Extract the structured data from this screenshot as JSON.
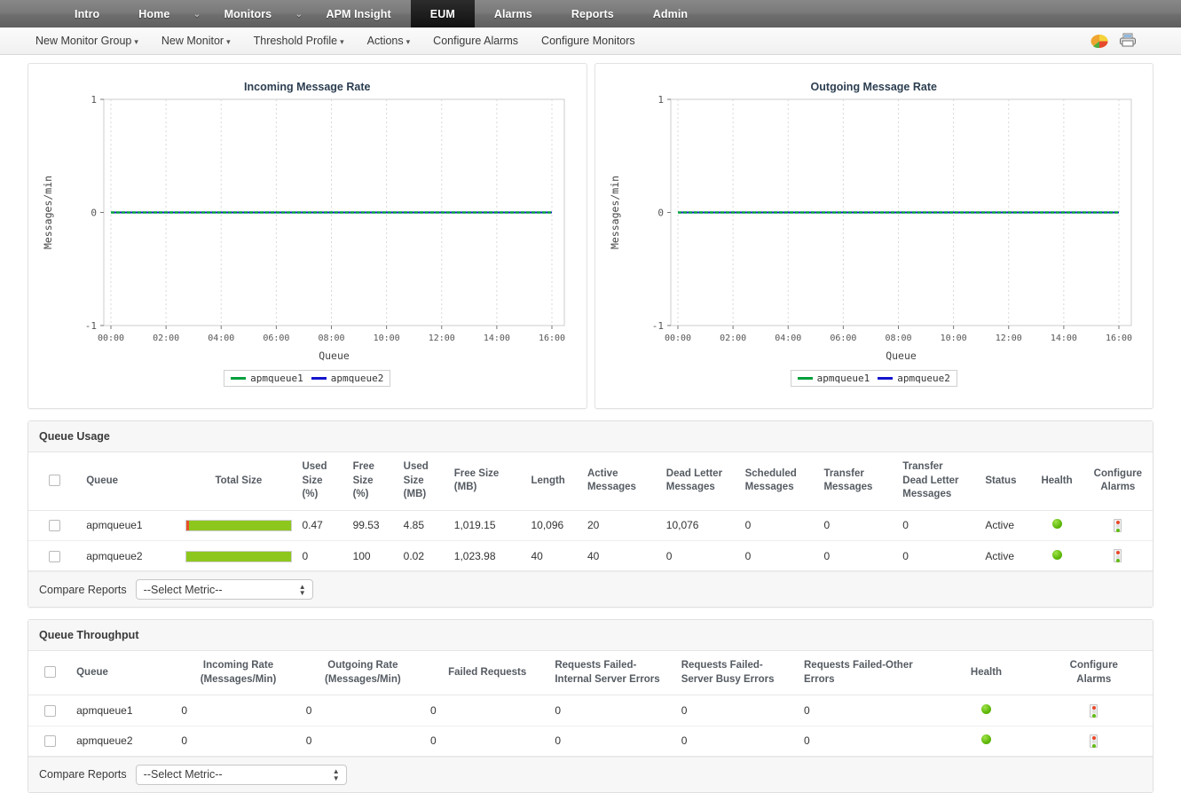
{
  "topnav": {
    "items": [
      {
        "label": "Intro",
        "active": false,
        "caret": false
      },
      {
        "label": "Home",
        "active": false,
        "caret": true
      },
      {
        "label": "Monitors",
        "active": false,
        "caret": true
      },
      {
        "label": "APM Insight",
        "active": false,
        "caret": false
      },
      {
        "label": "EUM",
        "active": true,
        "caret": false
      },
      {
        "label": "Alarms",
        "active": false,
        "caret": false
      },
      {
        "label": "Reports",
        "active": false,
        "caret": false
      },
      {
        "label": "Admin",
        "active": false,
        "caret": false
      }
    ],
    "caret_glyph": "⌄"
  },
  "subnav": {
    "items": [
      {
        "label": "New Monitor Group",
        "dropdown": true
      },
      {
        "label": "New Monitor",
        "dropdown": true
      },
      {
        "label": "Threshold Profile",
        "dropdown": true
      },
      {
        "label": "Actions",
        "dropdown": true
      },
      {
        "label": "Configure Alarms",
        "dropdown": false
      },
      {
        "label": "Configure Monitors",
        "dropdown": false
      }
    ],
    "dropdown_glyph": "▾",
    "icons": [
      "pie-chart-icon",
      "printer-icon"
    ]
  },
  "chart_data": [
    {
      "type": "line",
      "title": "Incoming Message Rate",
      "xlabel": "Queue",
      "ylabel": "Messages/min",
      "ylim": [
        -1,
        1
      ],
      "yticks": [
        "-1",
        "0",
        "1"
      ],
      "xticks": [
        "00:00",
        "02:00",
        "04:00",
        "06:00",
        "08:00",
        "10:00",
        "12:00",
        "14:00",
        "16:00"
      ],
      "grid": true,
      "legend_position": "bottom",
      "series": [
        {
          "name": "apmqueue1",
          "color": "#00a03c",
          "values": [
            0,
            0,
            0,
            0,
            0,
            0,
            0,
            0,
            0
          ]
        },
        {
          "name": "apmqueue2",
          "color": "#1414cc",
          "values": [
            0,
            0,
            0,
            0,
            0,
            0,
            0,
            0,
            0
          ]
        }
      ]
    },
    {
      "type": "line",
      "title": "Outgoing Message Rate",
      "xlabel": "Queue",
      "ylabel": "Messages/min",
      "ylim": [
        -1,
        1
      ],
      "yticks": [
        "-1",
        "0",
        "1"
      ],
      "xticks": [
        "00:00",
        "02:00",
        "04:00",
        "06:00",
        "08:00",
        "10:00",
        "12:00",
        "14:00",
        "16:00"
      ],
      "grid": true,
      "legend_position": "bottom",
      "series": [
        {
          "name": "apmqueue1",
          "color": "#00a03c",
          "values": [
            0,
            0,
            0,
            0,
            0,
            0,
            0,
            0,
            0
          ]
        },
        {
          "name": "apmqueue2",
          "color": "#1414cc",
          "values": [
            0,
            0,
            0,
            0,
            0,
            0,
            0,
            0,
            0
          ]
        }
      ]
    }
  ],
  "queue_usage": {
    "title": "Queue Usage",
    "columns": [
      "",
      "Queue",
      "Total Size",
      "Used Size (%)",
      "Free Size (%)",
      "Used Size (MB)",
      "Free Size (MB)",
      "Length",
      "Active Messages",
      "Dead Letter Messages",
      "Scheduled Messages",
      "Transfer Messages",
      "Transfer Dead Letter Messages",
      "Status",
      "Health",
      "Configure Alarms"
    ],
    "columns_multiline": [
      [
        "",
        ""
      ],
      [
        "Queue"
      ],
      [
        "Total Size"
      ],
      [
        "Used",
        "Size",
        "(%)"
      ],
      [
        "Free",
        "Size",
        "(%)"
      ],
      [
        "Used",
        "Size",
        "(MB)"
      ],
      [
        "Free Size",
        "(MB)"
      ],
      [
        "Length"
      ],
      [
        "Active",
        "Messages"
      ],
      [
        "Dead Letter",
        "Messages"
      ],
      [
        "Scheduled",
        "Messages"
      ],
      [
        "Transfer",
        "Messages"
      ],
      [
        "Transfer",
        "Dead Letter",
        "Messages"
      ],
      [
        "Status"
      ],
      [
        "Health"
      ],
      [
        "Configure",
        "Alarms"
      ]
    ],
    "rows": [
      {
        "queue": "apmqueue1",
        "used_pct_bar": 0.47,
        "used_size_pct": "0.47",
        "free_size_pct": "99.53",
        "used_size_mb": "4.85",
        "free_size_mb": "1,019.15",
        "length": "10,096",
        "active_messages": "20",
        "dead_letter_messages": "10,076",
        "scheduled_messages": "0",
        "transfer_messages": "0",
        "transfer_dead_letter_messages": "0",
        "status": "Active",
        "health": "green"
      },
      {
        "queue": "apmqueue2",
        "used_pct_bar": 0,
        "used_size_pct": "0",
        "free_size_pct": "100",
        "used_size_mb": "0.02",
        "free_size_mb": "1,023.98",
        "length": "40",
        "active_messages": "40",
        "dead_letter_messages": "0",
        "scheduled_messages": "0",
        "transfer_messages": "0",
        "transfer_dead_letter_messages": "0",
        "status": "Active",
        "health": "green"
      }
    ],
    "footer": {
      "label": "Compare Reports",
      "select_value": "--Select Metric--"
    }
  },
  "queue_throughput": {
    "title": "Queue Throughput",
    "columns_multiline": [
      [
        ""
      ],
      [
        "Queue"
      ],
      [
        "Incoming Rate",
        "(Messages/Min)"
      ],
      [
        "Outgoing Rate",
        "(Messages/Min)"
      ],
      [
        "Failed Requests"
      ],
      [
        "Requests Failed-",
        "Internal Server Errors"
      ],
      [
        "Requests Failed-",
        "Server Busy Errors"
      ],
      [
        "Requests Failed-Other",
        "Errors"
      ],
      [
        "Health"
      ],
      [
        "Configure",
        "Alarms"
      ]
    ],
    "rows": [
      {
        "queue": "apmqueue1",
        "incoming_rate": "0",
        "outgoing_rate": "0",
        "failed_requests": "0",
        "failed_internal_server": "0",
        "failed_server_busy": "0",
        "failed_other": "0",
        "health": "green"
      },
      {
        "queue": "apmqueue2",
        "incoming_rate": "0",
        "outgoing_rate": "0",
        "failed_requests": "0",
        "failed_internal_server": "0",
        "failed_server_busy": "0",
        "failed_other": "0",
        "health": "green"
      }
    ],
    "footer": {
      "label": "Compare Reports",
      "select_value": "--Select Metric--"
    }
  },
  "colors": {
    "accent_green": "#8dc71e",
    "series1": "#00a03c",
    "series2": "#1414cc",
    "health_green": "#62bb12",
    "alarm_red": "#e8472b"
  }
}
